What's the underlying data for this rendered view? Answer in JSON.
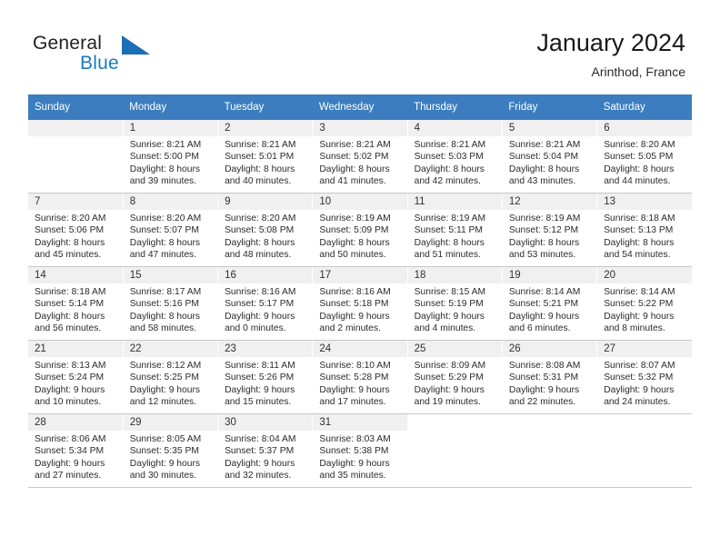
{
  "brand": {
    "name_part1": "General",
    "name_part2": "Blue",
    "mark": "triangle-logo"
  },
  "header": {
    "title": "January 2024",
    "subtitle": "Arinthod, France"
  },
  "colors": {
    "header_bar": "#3b7dbf",
    "brand_blue": "#1a7bc4",
    "daynum_bg": "#f0f0f0",
    "grid_line": "#c8c8c8"
  },
  "weekday_headers": [
    "Sunday",
    "Monday",
    "Tuesday",
    "Wednesday",
    "Thursday",
    "Friday",
    "Saturday"
  ],
  "weeks": [
    [
      {
        "day": "",
        "sunrise": "",
        "sunset": "",
        "daylight1": "",
        "daylight2": "",
        "empty": true
      },
      {
        "day": "1",
        "sunrise": "Sunrise: 8:21 AM",
        "sunset": "Sunset: 5:00 PM",
        "daylight1": "Daylight: 8 hours",
        "daylight2": "and 39 minutes."
      },
      {
        "day": "2",
        "sunrise": "Sunrise: 8:21 AM",
        "sunset": "Sunset: 5:01 PM",
        "daylight1": "Daylight: 8 hours",
        "daylight2": "and 40 minutes."
      },
      {
        "day": "3",
        "sunrise": "Sunrise: 8:21 AM",
        "sunset": "Sunset: 5:02 PM",
        "daylight1": "Daylight: 8 hours",
        "daylight2": "and 41 minutes."
      },
      {
        "day": "4",
        "sunrise": "Sunrise: 8:21 AM",
        "sunset": "Sunset: 5:03 PM",
        "daylight1": "Daylight: 8 hours",
        "daylight2": "and 42 minutes."
      },
      {
        "day": "5",
        "sunrise": "Sunrise: 8:21 AM",
        "sunset": "Sunset: 5:04 PM",
        "daylight1": "Daylight: 8 hours",
        "daylight2": "and 43 minutes."
      },
      {
        "day": "6",
        "sunrise": "Sunrise: 8:20 AM",
        "sunset": "Sunset: 5:05 PM",
        "daylight1": "Daylight: 8 hours",
        "daylight2": "and 44 minutes."
      }
    ],
    [
      {
        "day": "7",
        "sunrise": "Sunrise: 8:20 AM",
        "sunset": "Sunset: 5:06 PM",
        "daylight1": "Daylight: 8 hours",
        "daylight2": "and 45 minutes."
      },
      {
        "day": "8",
        "sunrise": "Sunrise: 8:20 AM",
        "sunset": "Sunset: 5:07 PM",
        "daylight1": "Daylight: 8 hours",
        "daylight2": "and 47 minutes."
      },
      {
        "day": "9",
        "sunrise": "Sunrise: 8:20 AM",
        "sunset": "Sunset: 5:08 PM",
        "daylight1": "Daylight: 8 hours",
        "daylight2": "and 48 minutes."
      },
      {
        "day": "10",
        "sunrise": "Sunrise: 8:19 AM",
        "sunset": "Sunset: 5:09 PM",
        "daylight1": "Daylight: 8 hours",
        "daylight2": "and 50 minutes."
      },
      {
        "day": "11",
        "sunrise": "Sunrise: 8:19 AM",
        "sunset": "Sunset: 5:11 PM",
        "daylight1": "Daylight: 8 hours",
        "daylight2": "and 51 minutes."
      },
      {
        "day": "12",
        "sunrise": "Sunrise: 8:19 AM",
        "sunset": "Sunset: 5:12 PM",
        "daylight1": "Daylight: 8 hours",
        "daylight2": "and 53 minutes."
      },
      {
        "day": "13",
        "sunrise": "Sunrise: 8:18 AM",
        "sunset": "Sunset: 5:13 PM",
        "daylight1": "Daylight: 8 hours",
        "daylight2": "and 54 minutes."
      }
    ],
    [
      {
        "day": "14",
        "sunrise": "Sunrise: 8:18 AM",
        "sunset": "Sunset: 5:14 PM",
        "daylight1": "Daylight: 8 hours",
        "daylight2": "and 56 minutes."
      },
      {
        "day": "15",
        "sunrise": "Sunrise: 8:17 AM",
        "sunset": "Sunset: 5:16 PM",
        "daylight1": "Daylight: 8 hours",
        "daylight2": "and 58 minutes."
      },
      {
        "day": "16",
        "sunrise": "Sunrise: 8:16 AM",
        "sunset": "Sunset: 5:17 PM",
        "daylight1": "Daylight: 9 hours",
        "daylight2": "and 0 minutes."
      },
      {
        "day": "17",
        "sunrise": "Sunrise: 8:16 AM",
        "sunset": "Sunset: 5:18 PM",
        "daylight1": "Daylight: 9 hours",
        "daylight2": "and 2 minutes."
      },
      {
        "day": "18",
        "sunrise": "Sunrise: 8:15 AM",
        "sunset": "Sunset: 5:19 PM",
        "daylight1": "Daylight: 9 hours",
        "daylight2": "and 4 minutes."
      },
      {
        "day": "19",
        "sunrise": "Sunrise: 8:14 AM",
        "sunset": "Sunset: 5:21 PM",
        "daylight1": "Daylight: 9 hours",
        "daylight2": "and 6 minutes."
      },
      {
        "day": "20",
        "sunrise": "Sunrise: 8:14 AM",
        "sunset": "Sunset: 5:22 PM",
        "daylight1": "Daylight: 9 hours",
        "daylight2": "and 8 minutes."
      }
    ],
    [
      {
        "day": "21",
        "sunrise": "Sunrise: 8:13 AM",
        "sunset": "Sunset: 5:24 PM",
        "daylight1": "Daylight: 9 hours",
        "daylight2": "and 10 minutes."
      },
      {
        "day": "22",
        "sunrise": "Sunrise: 8:12 AM",
        "sunset": "Sunset: 5:25 PM",
        "daylight1": "Daylight: 9 hours",
        "daylight2": "and 12 minutes."
      },
      {
        "day": "23",
        "sunrise": "Sunrise: 8:11 AM",
        "sunset": "Sunset: 5:26 PM",
        "daylight1": "Daylight: 9 hours",
        "daylight2": "and 15 minutes."
      },
      {
        "day": "24",
        "sunrise": "Sunrise: 8:10 AM",
        "sunset": "Sunset: 5:28 PM",
        "daylight1": "Daylight: 9 hours",
        "daylight2": "and 17 minutes."
      },
      {
        "day": "25",
        "sunrise": "Sunrise: 8:09 AM",
        "sunset": "Sunset: 5:29 PM",
        "daylight1": "Daylight: 9 hours",
        "daylight2": "and 19 minutes."
      },
      {
        "day": "26",
        "sunrise": "Sunrise: 8:08 AM",
        "sunset": "Sunset: 5:31 PM",
        "daylight1": "Daylight: 9 hours",
        "daylight2": "and 22 minutes."
      },
      {
        "day": "27",
        "sunrise": "Sunrise: 8:07 AM",
        "sunset": "Sunset: 5:32 PM",
        "daylight1": "Daylight: 9 hours",
        "daylight2": "and 24 minutes."
      }
    ],
    [
      {
        "day": "28",
        "sunrise": "Sunrise: 8:06 AM",
        "sunset": "Sunset: 5:34 PM",
        "daylight1": "Daylight: 9 hours",
        "daylight2": "and 27 minutes."
      },
      {
        "day": "29",
        "sunrise": "Sunrise: 8:05 AM",
        "sunset": "Sunset: 5:35 PM",
        "daylight1": "Daylight: 9 hours",
        "daylight2": "and 30 minutes."
      },
      {
        "day": "30",
        "sunrise": "Sunrise: 8:04 AM",
        "sunset": "Sunset: 5:37 PM",
        "daylight1": "Daylight: 9 hours",
        "daylight2": "and 32 minutes."
      },
      {
        "day": "31",
        "sunrise": "Sunrise: 8:03 AM",
        "sunset": "Sunset: 5:38 PM",
        "daylight1": "Daylight: 9 hours",
        "daylight2": "and 35 minutes."
      },
      {
        "day": "",
        "sunrise": "",
        "sunset": "",
        "daylight1": "",
        "daylight2": "",
        "blank": true
      },
      {
        "day": "",
        "sunrise": "",
        "sunset": "",
        "daylight1": "",
        "daylight2": "",
        "blank": true
      },
      {
        "day": "",
        "sunrise": "",
        "sunset": "",
        "daylight1": "",
        "daylight2": "",
        "blank": true
      }
    ]
  ]
}
